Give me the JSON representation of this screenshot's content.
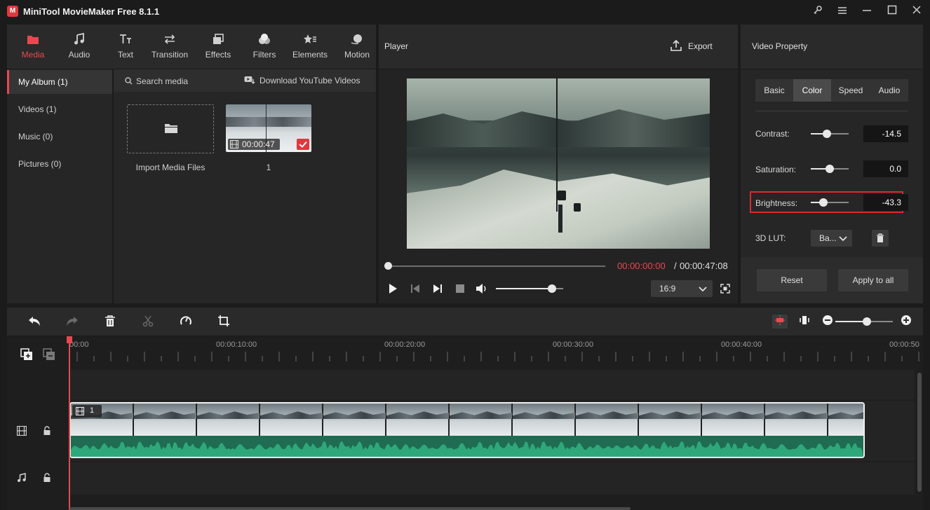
{
  "app": {
    "title": "MiniTool MovieMaker Free 8.1.1",
    "logo_letter": "M"
  },
  "toolbar": {
    "tabs": [
      {
        "label": "Media",
        "icon": "folder-icon"
      },
      {
        "label": "Audio",
        "icon": "music-note-icon"
      },
      {
        "label": "Text",
        "icon": "text-icon"
      },
      {
        "label": "Transition",
        "icon": "transition-arrows-icon"
      },
      {
        "label": "Effects",
        "icon": "effects-icon"
      },
      {
        "label": "Filters",
        "icon": "filters-icon"
      },
      {
        "label": "Elements",
        "icon": "elements-icon"
      },
      {
        "label": "Motion",
        "icon": "motion-icon"
      }
    ],
    "active_tab": "Media"
  },
  "album_nav": {
    "items": [
      {
        "label": "My Album (1)"
      },
      {
        "label": "Videos (1)"
      },
      {
        "label": "Music (0)"
      },
      {
        "label": "Pictures (0)"
      }
    ]
  },
  "media": {
    "search_placeholder": "Search media",
    "download_label": "Download YouTube Videos",
    "import_label": "Import Media Files",
    "clip": {
      "duration": "00:00:47",
      "name": "1"
    }
  },
  "player": {
    "title": "Player",
    "export_label": "Export",
    "current_time": "00:00:00:00",
    "time_separator": "/",
    "total_time": "00:00:47:08",
    "aspect_ratio": "16:9",
    "volume_level": 0.83,
    "progress": 0.0
  },
  "property": {
    "title": "Video Property",
    "tabs": [
      {
        "label": "Basic"
      },
      {
        "label": "Color"
      },
      {
        "label": "Speed"
      },
      {
        "label": "Audio"
      }
    ],
    "active_tab": "Color",
    "rows": [
      {
        "label": "Contrast:",
        "value": "-14.5",
        "level": 0.43
      },
      {
        "label": "Saturation:",
        "value": "0.0",
        "level": 0.5
      },
      {
        "label": "Brightness:",
        "value": "-43.3",
        "level": 0.34
      }
    ],
    "lut_label": "3D LUT:",
    "lut_value": "Ba...",
    "reset_label": "Reset",
    "apply_all_label": "Apply to all",
    "highlight_color": "#e0282e"
  },
  "timeline": {
    "ruler": [
      "00:00",
      "00:00:10:00",
      "00:00:20:00",
      "00:00:30:00",
      "00:00:40:00",
      "00:00:50"
    ],
    "clip_label": "1",
    "zoom_level": 0.55,
    "playhead_color": "#e8484e",
    "audio_wave_color": "#2ea87a"
  }
}
